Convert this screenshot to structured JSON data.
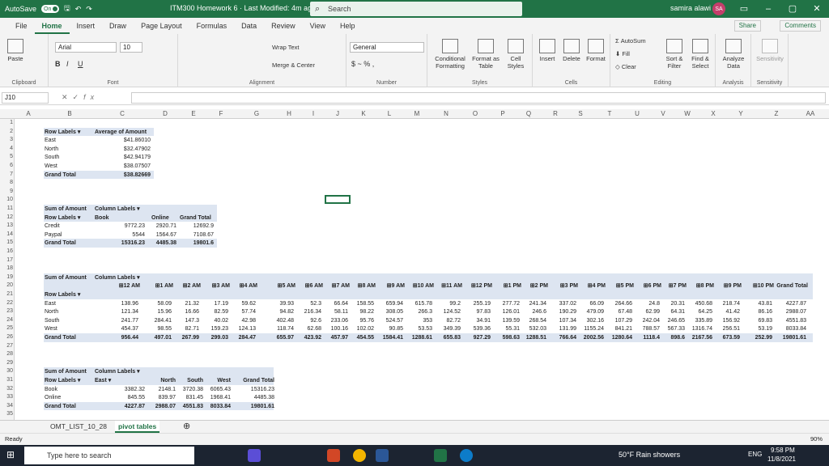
{
  "titlebar": {
    "autosave": "AutoSave",
    "toggle": "On",
    "doc": "ITM300 Homework 6  ·  Last Modified: 4m ago",
    "search": "Search",
    "user": "samira alawi",
    "initials": "SA"
  },
  "menu": [
    "File",
    "Home",
    "Insert",
    "Draw",
    "Page Layout",
    "Formulas",
    "Data",
    "Review",
    "View",
    "Help"
  ],
  "share": "Share",
  "comments": "Comments",
  "ribbon": {
    "paste": "Paste",
    "font": "Arial",
    "size": "10",
    "wrap": "Wrap Text",
    "merge": "Merge & Center",
    "numfmt": "General",
    "cond": "Conditional Formatting",
    "fmtas": "Format as Table",
    "cellstyles": "Cell Styles",
    "insert": "Insert",
    "delete": "Delete",
    "format": "Format",
    "autosum": "AutoSum",
    "fill": "Fill",
    "clear": "Clear",
    "sort": "Sort & Filter",
    "find": "Find & Select",
    "analyze": "Analyze Data",
    "sensitivity": "Sensitivity",
    "groups": [
      "Clipboard",
      "Font",
      "Alignment",
      "Number",
      "Styles",
      "Cells",
      "Editing",
      "Analysis",
      "Sensitivity"
    ]
  },
  "namebox": "J10",
  "fx": "fx",
  "columns": [
    "A",
    "B",
    "C",
    "D",
    "E",
    "F",
    "G",
    "H",
    "I",
    "J",
    "K",
    "L",
    "M",
    "N",
    "O",
    "P",
    "Q",
    "R",
    "S",
    "T",
    "U",
    "V",
    "W",
    "X",
    "Y",
    "Z",
    "AA"
  ],
  "pivot1": {
    "h1": "Row Labels",
    "h2": "Average of Amount",
    "rows": [
      [
        "East",
        "$41.86010"
      ],
      [
        "North",
        "$32.47902"
      ],
      [
        "South",
        "$42.94179"
      ],
      [
        "West",
        "$38.07507"
      ]
    ],
    "total": [
      "Grand Total",
      "$38.82669"
    ]
  },
  "pivot2": {
    "h1": "Sum of Amount",
    "h2": "Column Labels",
    "rl": "Row Labels",
    "c1": "Book",
    "c2": "Online",
    "c3": "Grand Total",
    "rows": [
      [
        "Credit",
        "9772.23",
        "2920.71",
        "12692.9"
      ],
      [
        "Paypal",
        "5544",
        "1564.67",
        "7108.67"
      ]
    ],
    "total": [
      "Grand Total",
      "15316.23",
      "4485.38",
      "19801.6"
    ]
  },
  "pivot3": {
    "h1": "Sum of Amount",
    "h2": "Column Labels",
    "rl": "Row Labels",
    "hours": [
      "12 AM",
      "1 AM",
      "2 AM",
      "3 AM",
      "4 AM",
      "5 AM",
      "6 AM",
      "7 AM",
      "8 AM",
      "9 AM",
      "10 AM",
      "11 AM",
      "12 PM",
      "1 PM",
      "2 PM",
      "3 PM",
      "4 PM",
      "5 PM",
      "6 PM",
      "7 PM",
      "8 PM",
      "9 PM",
      "10 PM",
      "Grand Total"
    ],
    "rows": [
      [
        "East",
        "138.96",
        "58.09",
        "21.32",
        "17.19",
        "59.62",
        "39.93",
        "52.3",
        "66.64",
        "158.55",
        "659.94",
        "615.78",
        "99.2",
        "255.19",
        "277.72",
        "241.34",
        "337.02",
        "66.09",
        "264.66",
        "24.8",
        "20.31",
        "450.68",
        "218.74",
        "43.81",
        "4227.87"
      ],
      [
        "North",
        "121.34",
        "15.96",
        "16.66",
        "82.59",
        "57.74",
        "94.82",
        "216.34",
        "58.11",
        "98.22",
        "308.05",
        "266.3",
        "124.52",
        "97.83",
        "126.01",
        "246.6",
        "190.29",
        "479.09",
        "67.48",
        "62.99",
        "64.31",
        "64.25",
        "41.42",
        "86.16",
        "2988.07"
      ],
      [
        "South",
        "241.77",
        "284.41",
        "147.3",
        "40.02",
        "42.98",
        "402.48",
        "92.6",
        "233.06",
        "95.76",
        "524.57",
        "353",
        "82.72",
        "34.91",
        "139.59",
        "268.54",
        "107.34",
        "302.16",
        "107.29",
        "242.04",
        "246.65",
        "335.89",
        "156.92",
        "69.83",
        "4551.83"
      ],
      [
        "West",
        "454.37",
        "98.55",
        "82.71",
        "159.23",
        "124.13",
        "118.74",
        "62.68",
        "100.16",
        "102.02",
        "90.85",
        "53.53",
        "349.39",
        "539.36",
        "55.31",
        "532.03",
        "131.99",
        "1155.24",
        "841.21",
        "788.57",
        "567.33",
        "1316.74",
        "256.51",
        "53.19",
        "8033.84"
      ]
    ],
    "total": [
      "Grand Total",
      "956.44",
      "497.01",
      "267.99",
      "299.03",
      "284.47",
      "655.97",
      "423.92",
      "457.97",
      "454.55",
      "1584.41",
      "1288.61",
      "655.83",
      "927.29",
      "598.63",
      "1288.51",
      "766.64",
      "2002.56",
      "1280.64",
      "1118.4",
      "898.6",
      "2167.56",
      "673.59",
      "252.99",
      "19801.61"
    ]
  },
  "pivot4": {
    "h1": "Sum of Amount",
    "h2": "Column Labels",
    "rl": "Row Labels",
    "cols": [
      "East",
      "North",
      "South",
      "West",
      "Grand Total"
    ],
    "rows": [
      [
        "Book",
        "3382.32",
        "2148.1",
        "3720.38",
        "6065.43",
        "15316.23"
      ],
      [
        "Online",
        "845.55",
        "839.97",
        "831.45",
        "1968.41",
        "4485.38"
      ]
    ],
    "total": [
      "Grand Total",
      "4227.87",
      "2988.07",
      "4551.83",
      "8033.84",
      "19801.61"
    ]
  },
  "sheets": [
    "OMT_LIST_10_28",
    "pivot tables"
  ],
  "status": {
    "ready": "Ready",
    "zoom": "90%"
  },
  "taskbar": {
    "search": "Type here to search",
    "weather": "50°F  Rain showers",
    "lang": "ENG",
    "time": "9:58 PM",
    "date": "11/8/2021"
  }
}
